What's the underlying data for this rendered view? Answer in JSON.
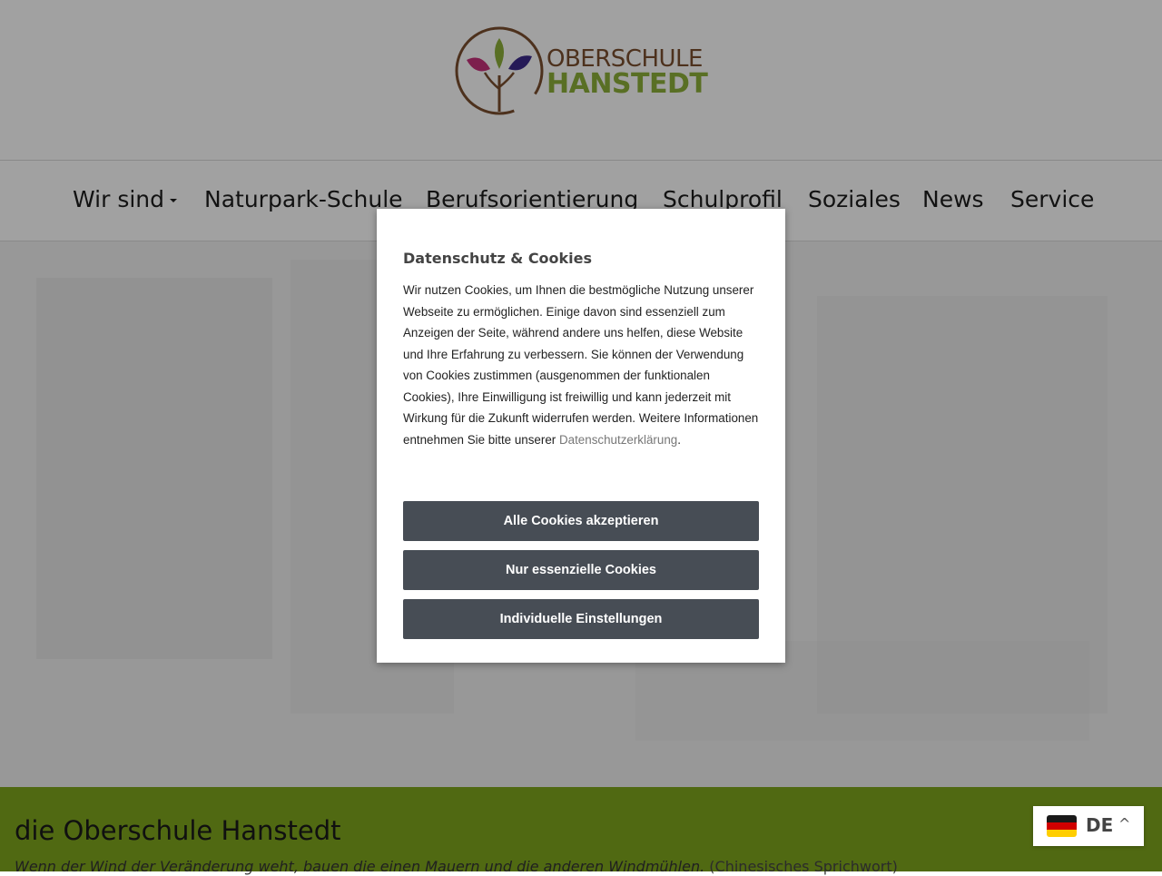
{
  "header": {
    "logo_line1": "OBERSCHULE",
    "logo_line2": "HANSTEDT"
  },
  "nav": {
    "items": [
      {
        "label": "Wir sind",
        "has_dropdown": true
      },
      {
        "label": "Naturpark-Schule"
      },
      {
        "label": "Berufsorientierung"
      },
      {
        "label": "Schulprofil"
      },
      {
        "label": "Soziales"
      },
      {
        "label": "News"
      },
      {
        "label": "Service"
      }
    ]
  },
  "band": {
    "title": "die Oberschule Hanstedt",
    "quote": "Wenn der Wind der Veränderung weht, bauen die einen Mauern und die anderen Windmühlen.",
    "quote_source": "(Chinesisches Sprichwort)"
  },
  "cookie_modal": {
    "title": "Datenschutz & Cookies",
    "text": "Wir nutzen Cookies, um Ihnen die bestmögliche Nutzung unserer Webseite zu ermöglichen. Einige davon sind essenziell zum Anzeigen der Seite, während andere uns helfen, diese Website und Ihre Erfahrung zu verbessern. Sie können der Verwendung von Cookies zustimmen (ausgenommen der funktionalen Cookies), Ihre Einwilligung ist freiwillig und kann jederzeit mit Wirkung für die Zukunft widerrufen werden. Weitere Informationen entnehmen Sie bitte unserer",
    "link_text": "Datenschutzerklärung",
    "text_end": ".",
    "buttons": {
      "accept_all": "Alle Cookies akzeptieren",
      "essential_only": "Nur essenzielle Cookies",
      "individual": "Individuelle Einstellungen"
    }
  },
  "language": {
    "code": "DE",
    "flag_icon": "germany-flag-icon",
    "chevron": "^"
  },
  "colors": {
    "green_band": "#7fa61e",
    "button_bg": "#474d55",
    "logo_brown": "#7a4f2e",
    "logo_green": "#8db03a"
  }
}
